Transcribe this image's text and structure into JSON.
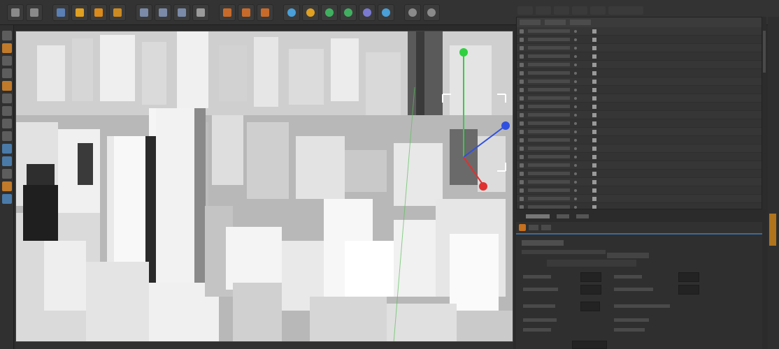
{
  "toolbar": {
    "buttons": [
      {
        "icon": "undo-icon",
        "color": "#8a8a8a"
      },
      {
        "icon": "redo-icon",
        "color": "#8a8a8a"
      },
      {
        "icon": "live-selection-icon",
        "color": "#5a7fb5"
      },
      {
        "icon": "move-icon",
        "color": "#e0a020"
      },
      {
        "icon": "scale-icon",
        "color": "#d98a1b"
      },
      {
        "icon": "rotate-icon",
        "color": "#cc8a20"
      },
      {
        "icon": "x-axis-icon",
        "color": "#7a8aa8"
      },
      {
        "icon": "y-axis-icon",
        "color": "#7a8aa8"
      },
      {
        "icon": "z-axis-icon",
        "color": "#7a8aa8"
      },
      {
        "icon": "coordinate-system-icon",
        "color": "#9a9a9a"
      },
      {
        "icon": "render-view-icon",
        "color": "#c86a2a"
      },
      {
        "icon": "render-picture-viewer-icon",
        "color": "#c86a2a"
      },
      {
        "icon": "render-settings-icon",
        "color": "#c86a2a"
      },
      {
        "icon": "cube-icon",
        "color": "#4aa0d8"
      },
      {
        "icon": "spline-icon",
        "color": "#e0a020"
      },
      {
        "icon": "nurbs-icon",
        "color": "#40b060"
      },
      {
        "icon": "array-icon",
        "color": "#40b060"
      },
      {
        "icon": "deformer-icon",
        "color": "#7a7ad0"
      },
      {
        "icon": "scene-icon",
        "color": "#4aa0d8"
      },
      {
        "icon": "camera-icon",
        "color": "#8a8a8a"
      },
      {
        "icon": "light-icon",
        "color": "#8a8a8a"
      }
    ]
  },
  "left_strip": {
    "buttons": [
      {
        "icon": "make-editable-icon",
        "color": "#5d5d5d"
      },
      {
        "icon": "model-mode-icon",
        "color": "#c07a2a"
      },
      {
        "icon": "texture-mode-icon",
        "color": "#5d5d5d"
      },
      {
        "icon": "workplane-icon",
        "color": "#5d5d5d"
      },
      {
        "icon": "points-mode-icon",
        "color": "#c07a2a"
      },
      {
        "icon": "edges-mode-icon",
        "color": "#5d5d5d"
      },
      {
        "icon": "polygons-mode-icon",
        "color": "#5d5d5d"
      },
      {
        "icon": "axis-mode-icon",
        "color": "#5d5d5d"
      },
      {
        "icon": "tweak-mode-icon",
        "color": "#5d5d5d"
      },
      {
        "icon": "snap-icon",
        "color": "#4a7aa8"
      },
      {
        "icon": "snap-settings-icon",
        "color": "#4a7aa8"
      },
      {
        "icon": "lock-workplane-icon",
        "color": "#5d5d5d"
      },
      {
        "icon": "solo-icon",
        "color": "#c07a2a"
      },
      {
        "icon": "solo-off-icon",
        "color": "#4a7aa8"
      }
    ]
  },
  "viewport": {
    "background": "#9a9a9a",
    "axis_colors": {
      "x": "#e03030",
      "y": "#30d040",
      "z": "#3050e0"
    }
  },
  "object_manager": {
    "row_count": 22,
    "rows": [
      {
        "label": ""
      }
    ]
  },
  "accent": {
    "orange": "#c7701e",
    "blue": "#3d6b9a"
  }
}
